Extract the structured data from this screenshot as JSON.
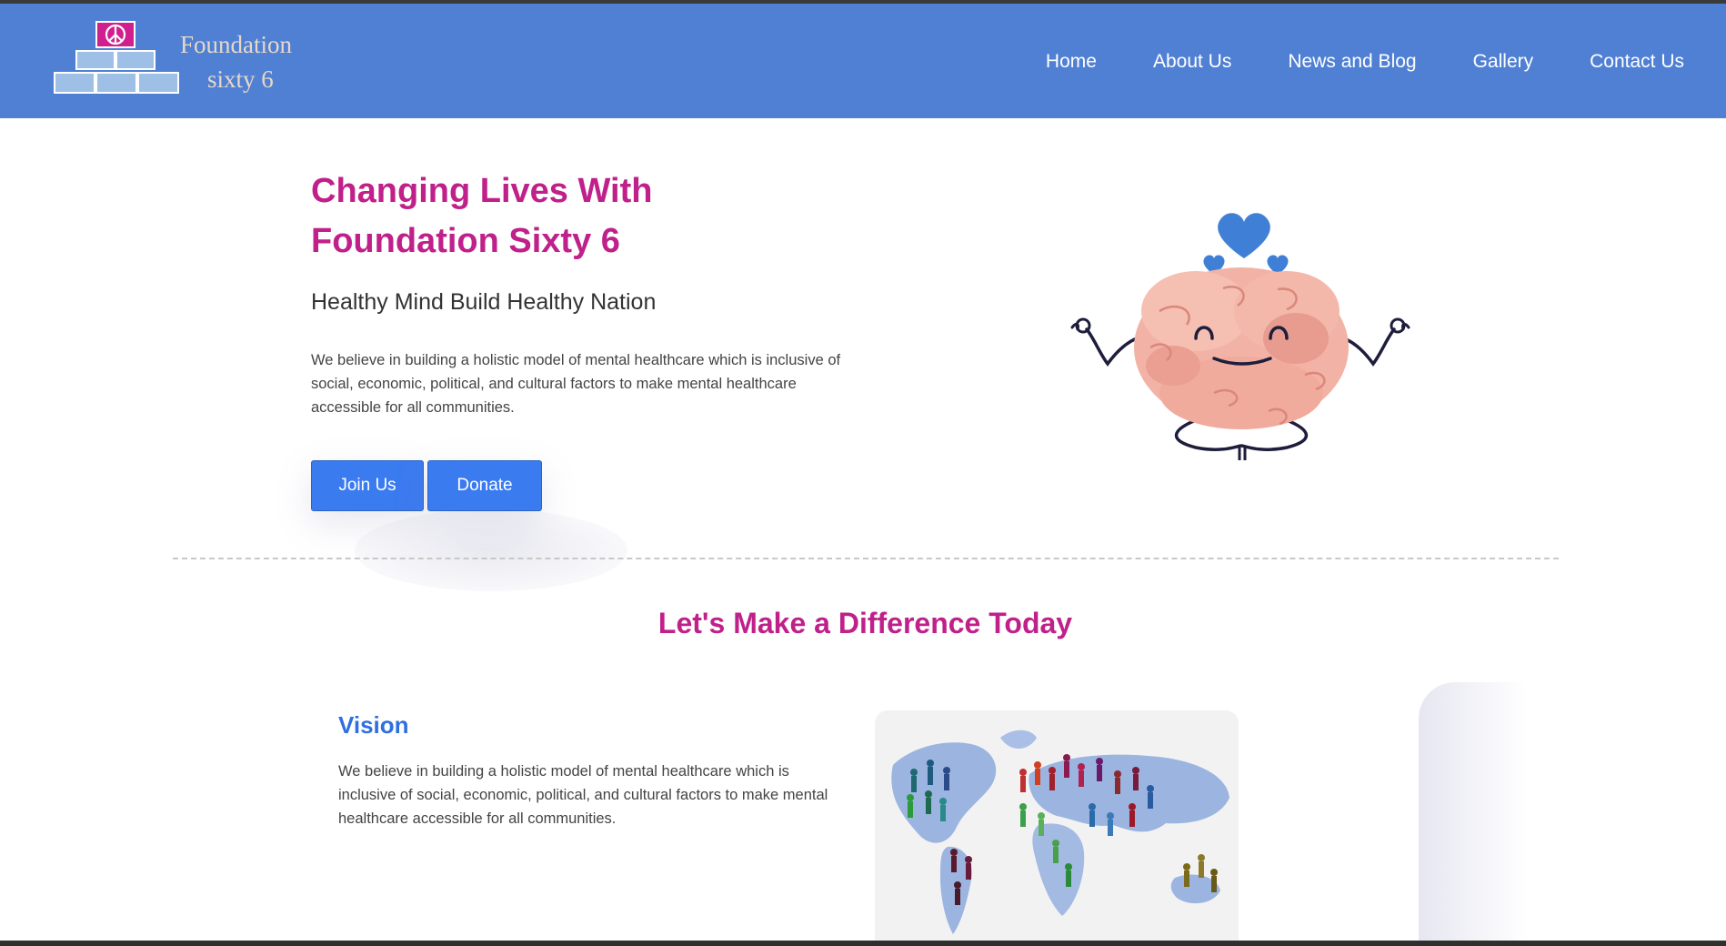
{
  "header": {
    "logo_line1": "Foundation",
    "logo_line2": "sixty  6",
    "nav": [
      {
        "label": "Home"
      },
      {
        "label": "About Us"
      },
      {
        "label": "News and Blog"
      },
      {
        "label": "Gallery"
      },
      {
        "label": "Contact Us"
      }
    ],
    "colors": {
      "bar": "#5080d4",
      "logo_text": "#e6d8c8",
      "peace_sign_bg": "#d02090"
    }
  },
  "hero": {
    "title_line1": "Changing Lives With",
    "title_line2": "Foundation Sixty 6",
    "subtitle": "Healthy Mind Build Healthy Nation",
    "body": "We believe in building a holistic model of mental healthcare which is inclusive of social, economic, political, and cultural factors to make mental healthcare accessible for all communities.",
    "join_button": "Join Us",
    "donate_button": "Donate",
    "illustration": "meditating-brain-icon"
  },
  "section": {
    "title": "Let's Make a Difference Today"
  },
  "vision": {
    "title": "Vision",
    "body": "We believe in building a holistic model of mental healthcare which is inclusive of social, economic, political, and cultural factors to make mental healthcare accessible for all communities.",
    "image": "world-map-people-icon"
  },
  "colors": {
    "accent_magenta": "#c0208a",
    "accent_blue": "#2f6fe0",
    "button_blue": "#3b7bf0"
  }
}
